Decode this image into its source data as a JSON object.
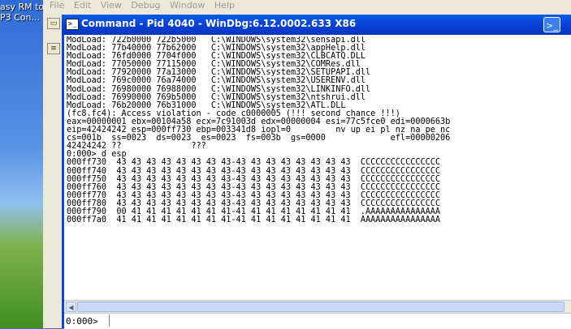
{
  "desktop": {
    "label_line1": "asy RM to",
    "label_line2": "P3 Con..."
  },
  "app": {
    "menu": [
      "File",
      "Edit",
      "View",
      "Debug",
      "Window",
      "Help"
    ]
  },
  "window": {
    "title": "Command - Pid 4040 - WinDbg:6.12.0002.633 X86",
    "prompt_icon": ">_",
    "output_lines": [
      "ModLoad: 722b0000 722b5000   C:\\WINDOWS\\system32\\sensapi.dll",
      "ModLoad: 77b40000 77b62000   C:\\WINDOWS\\system32\\appHelp.dll",
      "ModLoad: 76fd0000 7704f000   C:\\WINDOWS\\system32\\CLBCATQ.DLL",
      "ModLoad: 77050000 77115000   C:\\WINDOWS\\system32\\COMRes.dll",
      "ModLoad: 77920000 77a13000   C:\\WINDOWS\\system32\\SETUPAPI.dll",
      "ModLoad: 769c0000 76a74000   C:\\WINDOWS\\system32\\USERENV.dll",
      "ModLoad: 76980000 76988000   C:\\WINDOWS\\system32\\LINKINFO.dll",
      "ModLoad: 76990000 769b5000   C:\\WINDOWS\\system32\\ntshrui.dll",
      "ModLoad: 76b20000 76b31000   C:\\WINDOWS\\system32\\ATL.DLL",
      "(fc8.fc4): Access violation - code c0000005 (!!! second chance !!!)",
      "eax=00000001 ebx=00104a58 ecx=7c91003d edx=00000004 esi=77c5fce0 edi=0000663b",
      "eip=42424242 esp=000ff730 ebp=003341d8 iopl=0         nv up ei pl nz na pe nc",
      "cs=001b  ss=0023  ds=0023  es=0023  fs=003b  gs=0000             efl=00000206",
      "42424242 ??              ???",
      "0:000> d esp",
      "000ff730  43 43 43 43 43 43 43 43-43 43 43 43 43 43 43 43  CCCCCCCCCCCCCCCC",
      "000ff740  43 43 43 43 43 43 43 43-43 43 43 43 43 43 43 43  CCCCCCCCCCCCCCCC",
      "000ff750  43 43 43 43 43 43 43 43-43 43 43 43 43 43 43 43  CCCCCCCCCCCCCCCC",
      "000ff760  43 43 43 43 43 43 43 43-43 43 43 43 43 43 43 43  CCCCCCCCCCCCCCCC",
      "000ff770  43 43 43 43 43 43 43 43-43 43 43 43 43 43 43 43  CCCCCCCCCCCCCCCC",
      "000ff780  43 43 43 43 43 43 43 43-43 43 43 43 43 43 43 43  CCCCCCCCCCCCCCCC",
      "000ff790  00 41 41 41 41 41 41 41-41 41 41 41 41 41 41 41  .AAAAAAAAAAAAAAA",
      "000ff7a0  41 41 41 41 41 41 41 41-41 41 41 41 41 41 41 41  AAAAAAAAAAAAAAAA"
    ],
    "command_prompt": "0:000>",
    "command_value": ""
  }
}
